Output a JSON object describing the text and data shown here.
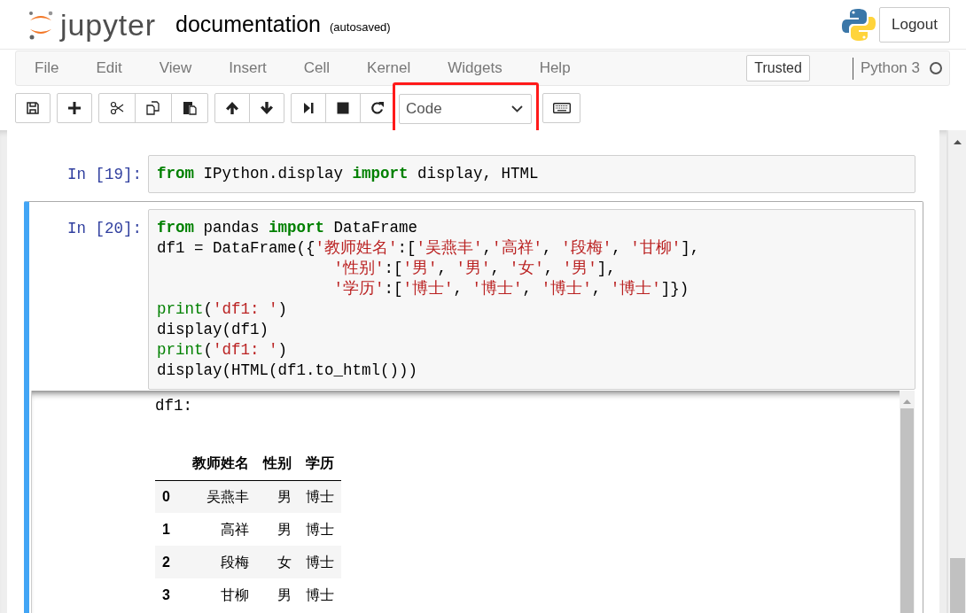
{
  "header": {
    "logo_text": "jupyter",
    "notebook_name": "documentation",
    "save_status": "(autosaved)",
    "logout_button": "Logout"
  },
  "menu": [
    "File",
    "Edit",
    "View",
    "Insert",
    "Cell",
    "Kernel",
    "Widgets",
    "Help"
  ],
  "trusted_badge": "Trusted",
  "kernel": {
    "name": "Python 3",
    "busy": false
  },
  "toolbar": {
    "cell_type": "Code"
  },
  "cells": [
    {
      "prompt": "In [19]:",
      "selected": false,
      "lines": [
        [
          {
            "kind": "keyword",
            "text": "from"
          },
          {
            "kind": "plain",
            "text": " IPython.display "
          },
          {
            "kind": "keyword",
            "text": "import"
          },
          {
            "kind": "plain",
            "text": " display, HTML"
          }
        ]
      ]
    },
    {
      "prompt": "In [20]:",
      "selected": true,
      "lines": [
        [
          {
            "kind": "keyword",
            "text": "from"
          },
          {
            "kind": "plain",
            "text": " pandas "
          },
          {
            "kind": "keyword",
            "text": "import"
          },
          {
            "kind": "plain",
            "text": " DataFrame"
          }
        ],
        [
          {
            "kind": "plain",
            "text": "df1 = DataFrame({"
          },
          {
            "kind": "string",
            "text": "'教师姓名'"
          },
          {
            "kind": "plain",
            "text": ":["
          },
          {
            "kind": "string",
            "text": "'吴燕丰'"
          },
          {
            "kind": "plain",
            "text": ","
          },
          {
            "kind": "string",
            "text": "'高祥'"
          },
          {
            "kind": "plain",
            "text": ", "
          },
          {
            "kind": "string",
            "text": "'段梅'"
          },
          {
            "kind": "plain",
            "text": ", "
          },
          {
            "kind": "string",
            "text": "'甘柳'"
          },
          {
            "kind": "plain",
            "text": "],"
          }
        ],
        [
          {
            "kind": "indent"
          },
          {
            "kind": "string",
            "text": "'性别'"
          },
          {
            "kind": "plain",
            "text": ":["
          },
          {
            "kind": "string",
            "text": "'男'"
          },
          {
            "kind": "plain",
            "text": ", "
          },
          {
            "kind": "string",
            "text": "'男'"
          },
          {
            "kind": "plain",
            "text": ", "
          },
          {
            "kind": "string",
            "text": "'女'"
          },
          {
            "kind": "plain",
            "text": ", "
          },
          {
            "kind": "string",
            "text": "'男'"
          },
          {
            "kind": "plain",
            "text": "],"
          }
        ],
        [
          {
            "kind": "indent"
          },
          {
            "kind": "string",
            "text": "'学历'"
          },
          {
            "kind": "plain",
            "text": ":["
          },
          {
            "kind": "string",
            "text": "'博士'"
          },
          {
            "kind": "plain",
            "text": ", "
          },
          {
            "kind": "string",
            "text": "'博士'"
          },
          {
            "kind": "plain",
            "text": ", "
          },
          {
            "kind": "string",
            "text": "'博士'"
          },
          {
            "kind": "plain",
            "text": ", "
          },
          {
            "kind": "string",
            "text": "'博士'"
          },
          {
            "kind": "plain",
            "text": "]})"
          }
        ],
        [
          {
            "kind": "builtin",
            "text": "print"
          },
          {
            "kind": "plain",
            "text": "("
          },
          {
            "kind": "string",
            "text": "'df1: '"
          },
          {
            "kind": "plain",
            "text": ")"
          }
        ],
        [
          {
            "kind": "plain",
            "text": "display(df1)"
          }
        ],
        [
          {
            "kind": "builtin",
            "text": "print"
          },
          {
            "kind": "plain",
            "text": "("
          },
          {
            "kind": "string",
            "text": "'df1: '"
          },
          {
            "kind": "plain",
            "text": ")"
          }
        ],
        [
          {
            "kind": "plain",
            "text": "display(HTML(df1.to_html()))"
          }
        ]
      ],
      "output": {
        "stream": "df1:",
        "table": {
          "columns": [
            "教师姓名",
            "性别",
            "学历"
          ],
          "rows": [
            {
              "index": "0",
              "cells": [
                "吴燕丰",
                "男",
                "博士"
              ]
            },
            {
              "index": "1",
              "cells": [
                "高祥",
                "男",
                "博士"
              ]
            },
            {
              "index": "2",
              "cells": [
                "段梅",
                "女",
                "博士"
              ]
            },
            {
              "index": "3",
              "cells": [
                "甘柳",
                "男",
                "博士"
              ]
            }
          ]
        }
      }
    }
  ]
}
